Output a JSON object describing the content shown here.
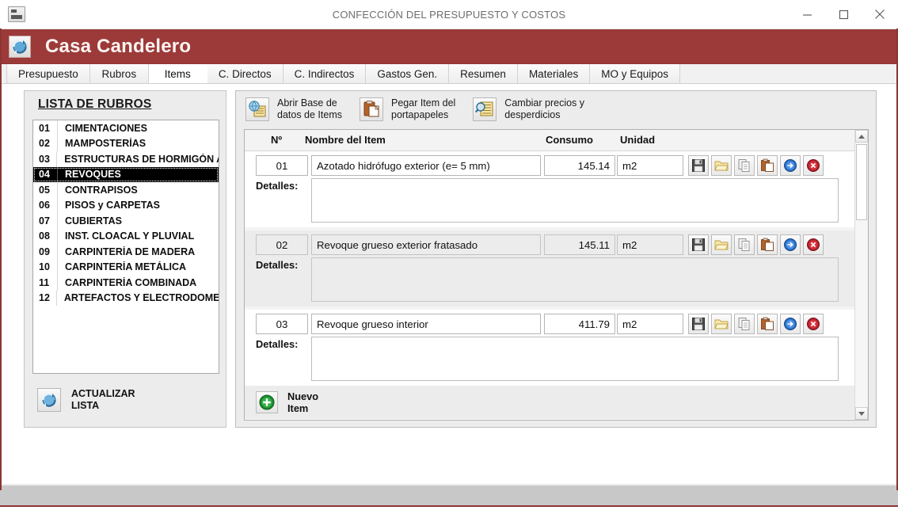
{
  "window": {
    "title": "CONFECCIÓN DEL PRESUPUESTO Y COSTOS",
    "app_icon": "window-app-icon",
    "minimize_label": "—",
    "maximize_label": "□",
    "close_label": "✕"
  },
  "brand": {
    "title": "Casa Candelero",
    "icon": "globe-refresh-icon",
    "color": "#9c3a3a"
  },
  "tabs": [
    {
      "label": "Presupuesto",
      "active": false
    },
    {
      "label": "Rubros",
      "active": false
    },
    {
      "label": "Items",
      "active": true
    },
    {
      "label": "C. Directos",
      "active": false
    },
    {
      "label": "C. Indirectos",
      "active": false
    },
    {
      "label": "Gastos Gen.",
      "active": false
    },
    {
      "label": "Resumen",
      "active": false
    },
    {
      "label": "Materiales",
      "active": false
    },
    {
      "label": "MO y Equipos",
      "active": false
    }
  ],
  "left_panel": {
    "title": "LISTA DE RUBROS",
    "rubros": [
      {
        "num": "01",
        "name": "CIMENTACIONES",
        "selected": false
      },
      {
        "num": "02",
        "name": "MAMPOSTERÍAS",
        "selected": false
      },
      {
        "num": "03",
        "name": "ESTRUCTURAS DE HORMIGÓN A",
        "selected": false
      },
      {
        "num": "04",
        "name": "REVOQUES",
        "selected": true
      },
      {
        "num": "05",
        "name": "CONTRAPISOS",
        "selected": false
      },
      {
        "num": "06",
        "name": "PISOS y CARPETAS",
        "selected": false
      },
      {
        "num": "07",
        "name": "CUBIERTAS",
        "selected": false
      },
      {
        "num": "08",
        "name": "INST. CLOACAL Y PLUVIAL",
        "selected": false
      },
      {
        "num": "09",
        "name": "CARPINTERÍA DE MADERA",
        "selected": false
      },
      {
        "num": "10",
        "name": "CARPINTERÍA METÁLICA",
        "selected": false
      },
      {
        "num": "11",
        "name": "CARPINTERÍA COMBINADA",
        "selected": false
      },
      {
        "num": "12",
        "name": "ARTEFACTOS Y ELECTRODOMES",
        "selected": false
      }
    ],
    "refresh_button": {
      "line1": "ACTUALIZAR",
      "line2": "LISTA",
      "icon": "globe-refresh-icon"
    }
  },
  "toolbar": [
    {
      "line1": "Abrir Base de",
      "line2": "datos de Items",
      "icon": "database-globe-icon"
    },
    {
      "line1": "Pegar Item del",
      "line2": "portapapeles",
      "icon": "clipboard-paste-icon"
    },
    {
      "line1": "Cambiar precios y",
      "line2": "desperdicios",
      "icon": "price-search-icon"
    }
  ],
  "grid": {
    "headers": {
      "num": "Nº",
      "name": "Nombre del Item",
      "consumo": "Consumo",
      "unidad": "Unidad"
    },
    "detalles_label": "Detalles:",
    "row_actions": [
      {
        "name": "save-icon",
        "title": "Guardar"
      },
      {
        "name": "open-folder-icon",
        "title": "Abrir"
      },
      {
        "name": "copy-icon",
        "title": "Copiar"
      },
      {
        "name": "paste-icon",
        "title": "Pegar"
      },
      {
        "name": "goto-arrow-icon",
        "title": "Ir a"
      },
      {
        "name": "delete-icon",
        "title": "Eliminar"
      }
    ],
    "items": [
      {
        "num": "01",
        "name": "Azotado hidrófugo exterior (e= 5 mm)",
        "consumo": "145.14",
        "unidad": "m2",
        "detalles": "",
        "alt": false
      },
      {
        "num": "02",
        "name": "Revoque grueso exterior fratasado",
        "consumo": "145.11",
        "unidad": "m2",
        "detalles": "",
        "alt": true
      },
      {
        "num": "03",
        "name": "Revoque grueso interior",
        "consumo": "411.79",
        "unidad": "m2",
        "detalles": "",
        "alt": false
      }
    ],
    "new_item": {
      "line1": "Nuevo",
      "line2": "Item",
      "icon": "plus-circle-icon"
    }
  },
  "scrollbar": {
    "up_icon": "scroll-up-arrow-icon",
    "down_icon": "scroll-down-arrow-icon",
    "thumb": "scroll-thumb"
  }
}
